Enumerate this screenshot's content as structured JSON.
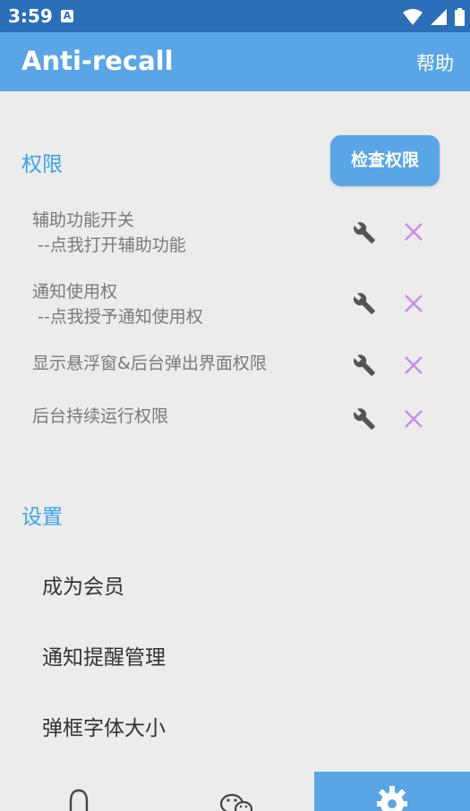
{
  "status": {
    "time": "3:59",
    "notification_letter": "A"
  },
  "app": {
    "title": "Anti-recall",
    "help_label": "帮助"
  },
  "permissions": {
    "section_title": "权限",
    "check_button_label": "检查权限",
    "items": [
      {
        "text": "辅助功能开关\n --点我打开辅助功能"
      },
      {
        "text": "通知使用权\n --点我授予通知使用权"
      },
      {
        "text": "显示悬浮窗&后台弹出界面权限"
      },
      {
        "text": "后台持续运行权限"
      }
    ]
  },
  "settings": {
    "section_title": "设置",
    "items": [
      {
        "label": "成为会员"
      },
      {
        "label": "通知提醒管理"
      },
      {
        "label": "弹框字体大小"
      }
    ]
  },
  "bottom_nav": {
    "items": [
      {
        "icon": "penguin-icon",
        "active": false
      },
      {
        "icon": "wechat-icon",
        "active": false
      },
      {
        "icon": "gear-icon",
        "active": true
      }
    ]
  },
  "colors": {
    "status_bar": "#2b6fb8",
    "app_bar": "#5aa5e6",
    "section_title": "#3ca2ea",
    "cross": "#c98ee8",
    "background": "#ececec"
  }
}
